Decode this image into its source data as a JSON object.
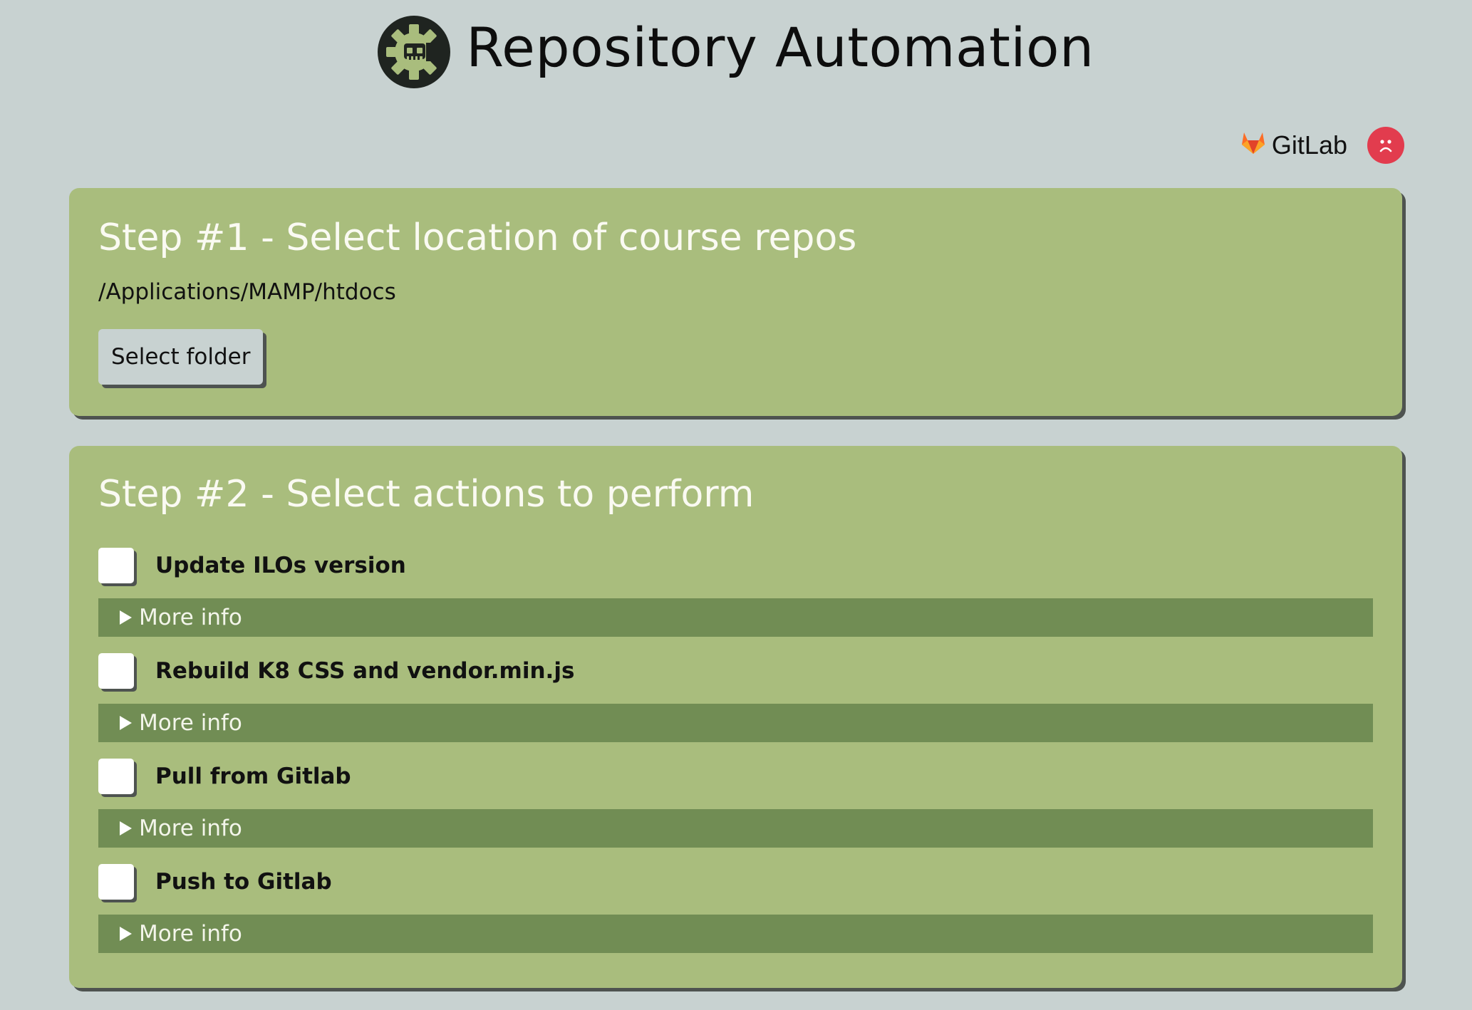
{
  "header": {
    "title": "Repository Automation",
    "logo_icon": "gear-robot-icon"
  },
  "topbar": {
    "gitlab_label": "GitLab",
    "gitlab_icon": "gitlab-fox-icon",
    "status_icon": "sad-face-icon",
    "status_color": "#e23c4e"
  },
  "step1": {
    "title": "Step #1 - Select location of course repos",
    "path": "/Applications/MAMP/htdocs",
    "button_label": "Select folder"
  },
  "step2": {
    "title": "Step #2 - Select actions to perform",
    "actions": [
      {
        "label": "Update ILOs version",
        "checked": false,
        "more_info": "More info"
      },
      {
        "label": "Rebuild K8 CSS and vendor.min.js",
        "checked": false,
        "more_info": "More info"
      },
      {
        "label": "Pull from Gitlab",
        "checked": false,
        "more_info": "More info"
      },
      {
        "label": "Push to Gitlab",
        "checked": false,
        "more_info": "More info"
      }
    ]
  },
  "colors": {
    "background": "#c8d2d1",
    "card": "#a9bd7d",
    "details_bar": "#718d54",
    "shadow": "#4e5350"
  }
}
